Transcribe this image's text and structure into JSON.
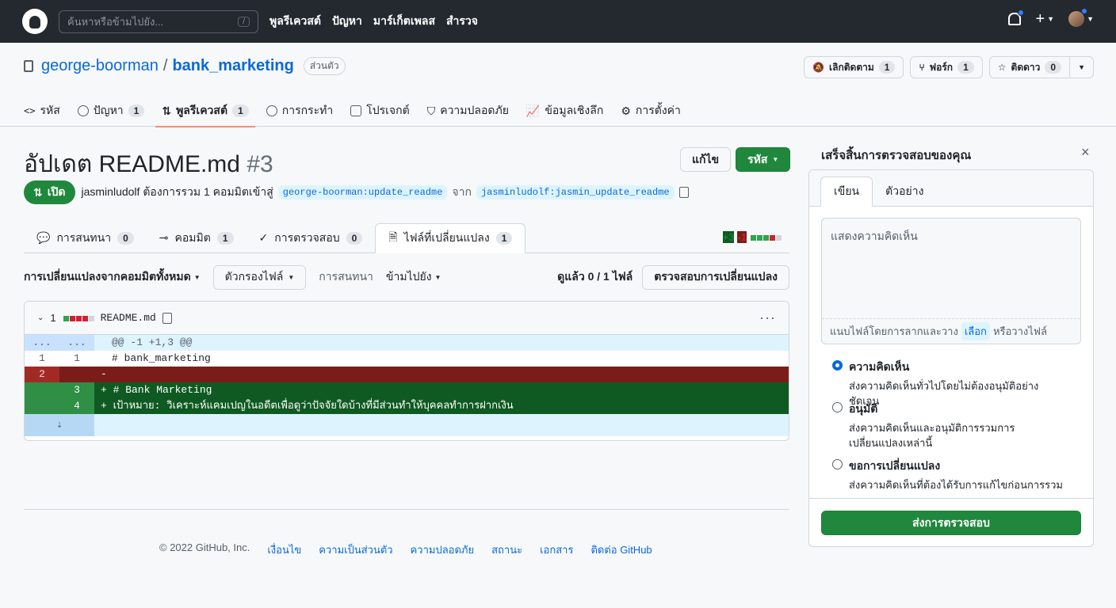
{
  "topbar": {
    "search_placeholder": "ค้นหาหรือข้ามไปยัง...",
    "search_shortcut": "/",
    "nav": [
      "พูลรีเควสต์",
      "ปัญหา",
      "มาร์เก็ตเพลส",
      "สำรวจ"
    ],
    "plus": "+"
  },
  "repo": {
    "owner": "george-boorman",
    "sep": "/",
    "name": "bank_marketing",
    "visibility": "ส่วนตัว",
    "actions": {
      "unwatch_label": "เลิกติดตาม",
      "unwatch_count": "1",
      "fork_label": "ฟอร์ก",
      "fork_count": "1",
      "star_label": "ติดดาว",
      "star_count": "0"
    },
    "nav": [
      {
        "label": "รหัส",
        "count": ""
      },
      {
        "label": "ปัญหา",
        "count": "1"
      },
      {
        "label": "พูลรีเควสต์",
        "count": "1"
      },
      {
        "label": "การกระทำ",
        "count": ""
      },
      {
        "label": "โปรเจกต์",
        "count": ""
      },
      {
        "label": "ความปลอดภัย",
        "count": ""
      },
      {
        "label": "ข้อมูลเชิงลึก",
        "count": ""
      },
      {
        "label": "การตั้งค่า",
        "count": ""
      }
    ]
  },
  "pr": {
    "title": "อัปเดต README.md",
    "number": "#3",
    "edit_label": "แก้ไข",
    "code_label": "รหัส",
    "state": "เปิด",
    "meta_text": "jasminludolf ต้องการรวม 1 คอมมิตเข้าสู่",
    "base_branch": "george-boorman:update_readme",
    "from_text": "จาก",
    "head_branch": "jasminludolf:jasmin_update_readme",
    "tabs": [
      {
        "label": "การสนทนา",
        "count": "0"
      },
      {
        "label": "คอมมิต",
        "count": "1"
      },
      {
        "label": "การตรวจสอบ",
        "count": "0"
      },
      {
        "label": "ไฟล์ที่เปลี่ยนแปลง",
        "count": "1"
      }
    ],
    "diffstat_add": "+3",
    "diffstat_del": "-1"
  },
  "toolbar": {
    "changes_from": "การเปลี่ยนแปลงจากคอมมิตทั้งหมด",
    "file_filter": "ตัวกรองไฟล์",
    "conversations": "การสนทนา",
    "jump_to": "ข้ามไปยัง",
    "viewed": "ดูแล้ว 0 / 1 ไฟล์",
    "review_changes": "ตรวจสอบการเปลี่ยนแปลง"
  },
  "file": {
    "changes_count": "1",
    "filename": "README.md",
    "menu": "···",
    "lines": [
      {
        "type": "hunk",
        "old": "...",
        "new": "...",
        "code": "@@ -1 +1,3 @@"
      },
      {
        "type": "ctx",
        "old": "1",
        "new": "1",
        "code": "# bank_marketing"
      },
      {
        "type": "del",
        "old": "2",
        "new": "",
        "code": "-"
      },
      {
        "type": "add",
        "old": "",
        "new": "3",
        "code": "+ # Bank Marketing"
      },
      {
        "type": "add",
        "old": "",
        "new": "4",
        "code": "+ เป้าหมาย: วิเคราะห์แคมเปญในอดีตเพื่อดูว่าปัจจัยใดบ้างที่มีส่วนทำให้บุคคลทำการฝากเงิน"
      }
    ]
  },
  "footer": {
    "copyright": "© 2022 GitHub, Inc.",
    "links": [
      "เงื่อนไข",
      "ความเป็นส่วนตัว",
      "ความปลอดภัย",
      "สถานะ",
      "เอกสาร",
      "ติดต่อ GitHub"
    ]
  },
  "review": {
    "title": "เสร็จสิ้นการตรวจสอบของคุณ",
    "close": "×",
    "tab_write": "เขียน",
    "tab_preview": "ตัวอย่าง",
    "placeholder": "แสดงความคิดเห็น",
    "attach_prefix": "แนบไฟล์โดยการลากและวาง",
    "attach_select": "เลือก",
    "attach_suffix": "หรือวางไฟล์",
    "options": [
      {
        "title": "ความคิดเห็น",
        "desc": "ส่งความคิดเห็นทั่วไปโดยไม่ต้องอนุมัติอย่างชัดเจน",
        "selected": true
      },
      {
        "title": "อนุมัติ",
        "desc": "ส่งความคิดเห็นและอนุมัติการรวมการเปลี่ยนแปลงเหล่านี้",
        "selected": false
      },
      {
        "title": "ขอการเปลี่ยนแปลง",
        "desc": "ส่งความคิดเห็นที่ต้องได้รับการแก้ไขก่อนการรวม",
        "selected": false
      }
    ],
    "submit": "ส่งการตรวจสอบ"
  }
}
